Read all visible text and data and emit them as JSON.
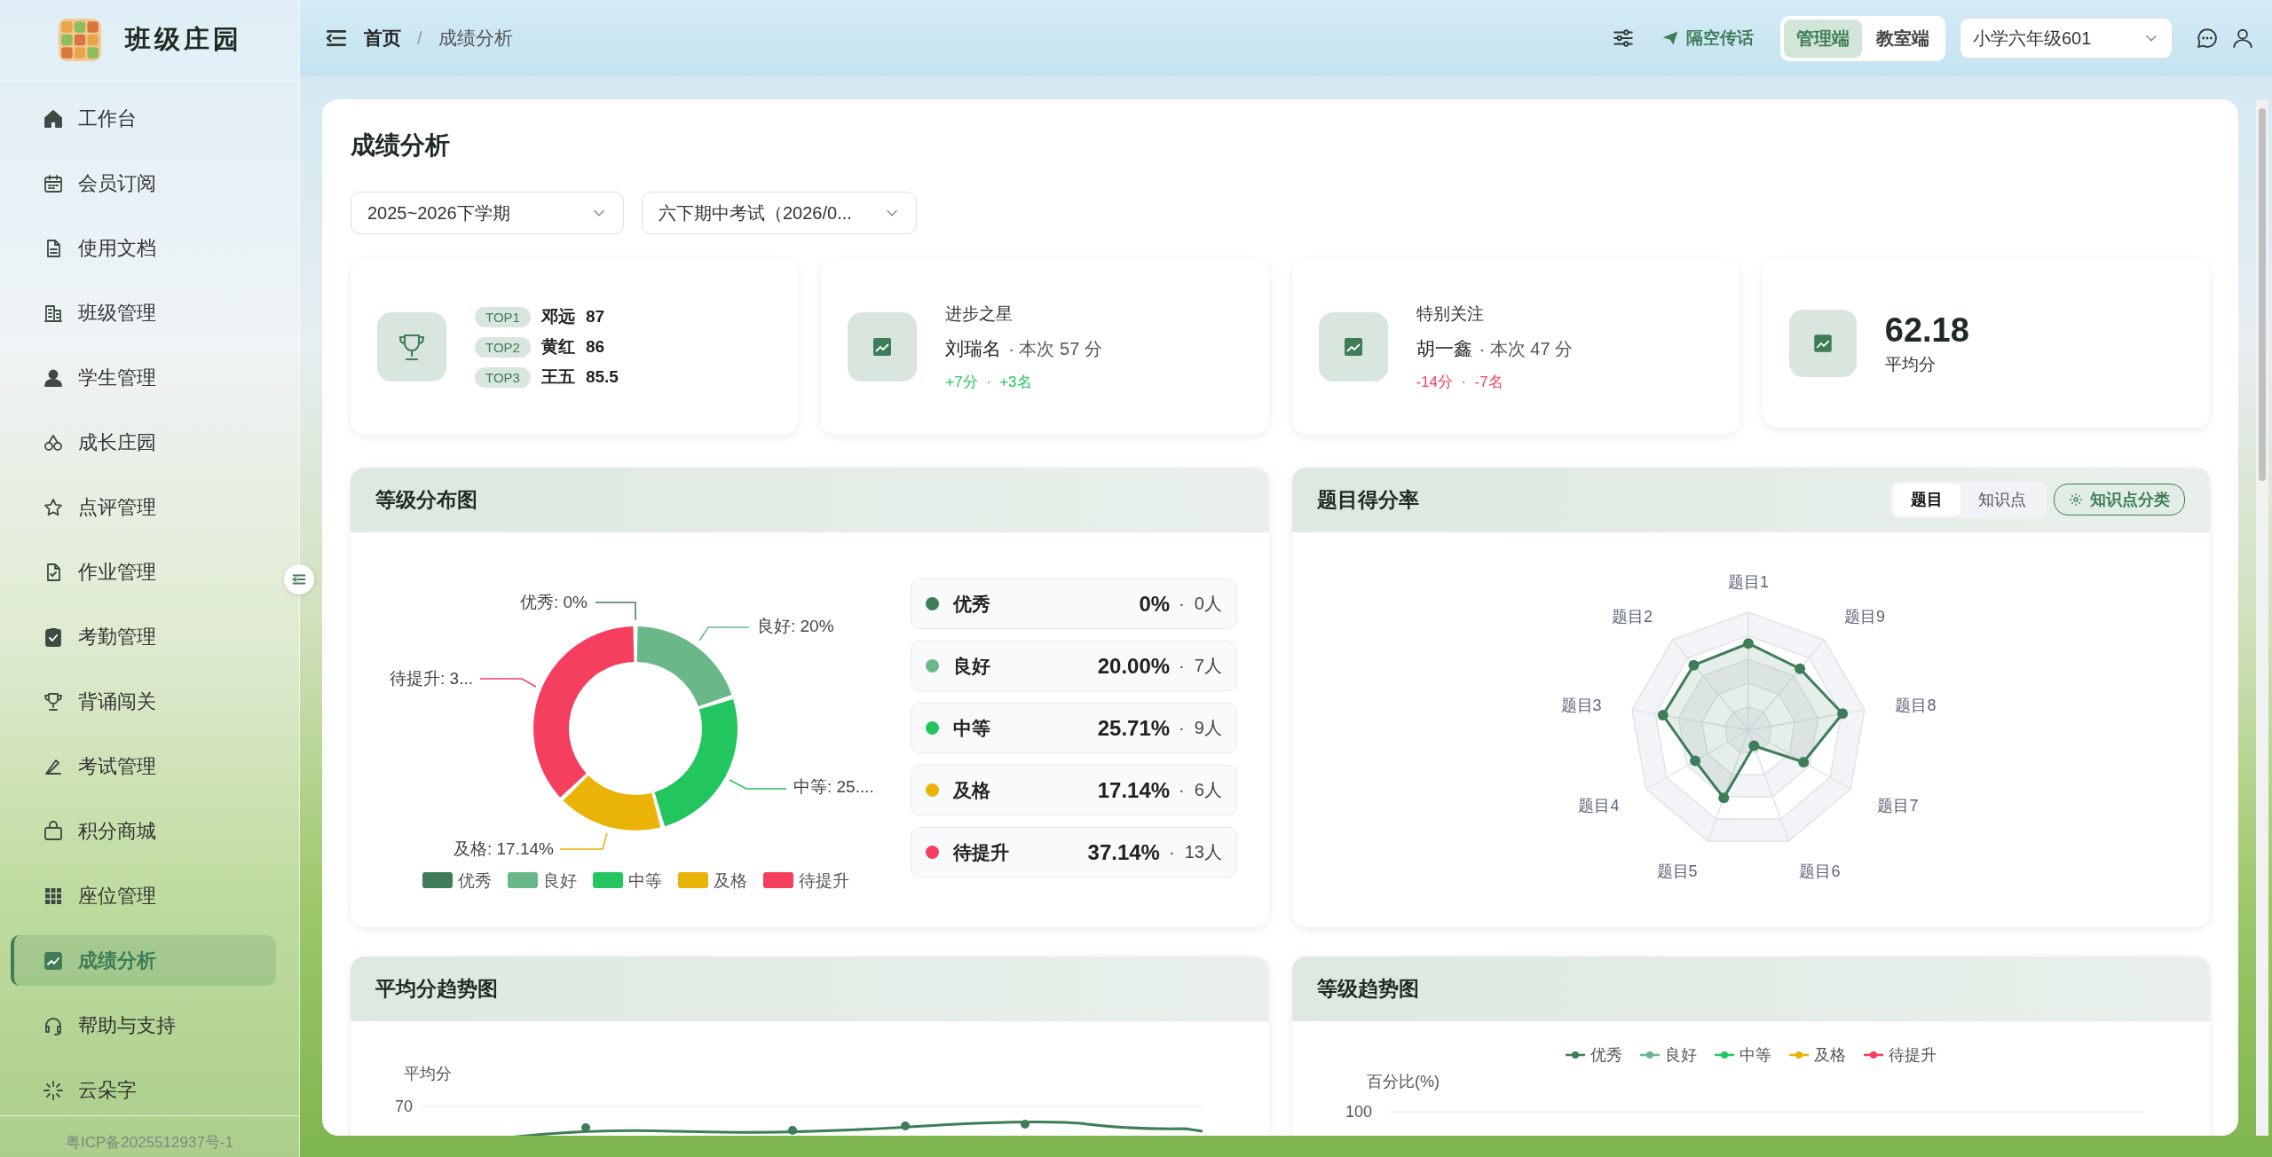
{
  "sidebar": {
    "brand": "班级庄园",
    "items": [
      {
        "label": "工作台",
        "selected": false
      },
      {
        "label": "会员订阅",
        "selected": false
      },
      {
        "label": "使用文档",
        "selected": false
      },
      {
        "label": "班级管理",
        "selected": false
      },
      {
        "label": "学生管理",
        "selected": false
      },
      {
        "label": "成长庄园",
        "selected": false
      },
      {
        "label": "点评管理",
        "selected": false
      },
      {
        "label": "作业管理",
        "selected": false
      },
      {
        "label": "考勤管理",
        "selected": false
      },
      {
        "label": "背诵闯关",
        "selected": false
      },
      {
        "label": "考试管理",
        "selected": false
      },
      {
        "label": "积分商城",
        "selected": false
      },
      {
        "label": "座位管理",
        "selected": false
      },
      {
        "label": "成绩分析",
        "selected": true
      },
      {
        "label": "帮助与支持",
        "selected": false
      },
      {
        "label": "云朵字",
        "selected": false
      }
    ],
    "footer": "粤ICP备2025512937号-1"
  },
  "topbar": {
    "breadcrumb": [
      "首页",
      "成绩分析"
    ],
    "breadcrumb_separator": "/",
    "broadcast": "隔空传话",
    "modes": [
      {
        "label": "管理端",
        "selected": true
      },
      {
        "label": "教室端",
        "selected": false
      }
    ],
    "class_select": {
      "value": "小学六年级601"
    }
  },
  "page": {
    "title": "成绩分析",
    "filters": [
      {
        "value": "2025~2026下学期"
      },
      {
        "value": "六下期中考试（2026/0..."
      }
    ]
  },
  "summary_cards": [
    {
      "kind": "ranking",
      "ranks": [
        {
          "badge": "TOP1",
          "name": "邓远",
          "score": "87"
        },
        {
          "badge": "TOP2",
          "name": "黄红",
          "score": "86"
        },
        {
          "badge": "TOP3",
          "name": "王五",
          "score": "85.5"
        }
      ]
    },
    {
      "kind": "student",
      "title": "进步之星",
      "name": "刘瑞名",
      "detail": "· 本次 57 分",
      "changes": "+7分  ·  +3名",
      "improved": true
    },
    {
      "kind": "student",
      "title": "特别关注",
      "name": "胡一鑫",
      "detail": "· 本次 47 分",
      "changes": "-14分  ·  -7名",
      "improved": false
    },
    {
      "kind": "average",
      "value": "62.18",
      "label": "平均分"
    }
  ],
  "grade_distribution": {
    "title": "等级分布图",
    "chart_data": {
      "type": "donut",
      "categories": [
        "优秀",
        "良好",
        "中等",
        "及格",
        "待提升"
      ],
      "values": [
        0,
        20,
        25.71,
        17.14,
        37.14
      ],
      "colors": [
        "#3e7d57",
        "#6ab88a",
        "#22c55e",
        "#eab308",
        "#f43f5e"
      ],
      "legend": true,
      "value_labels": [
        "优秀: 0%",
        "良好: 20%",
        "中等: 25....",
        "及格: 17.14%",
        "待提升: 3..."
      ]
    },
    "grades": [
      {
        "name": "优秀",
        "color": "#3e7d57",
        "percent": "0%",
        "count": "·  0人"
      },
      {
        "name": "良好",
        "color": "#6ab88a",
        "percent": "20.00%",
        "count": "·  7人"
      },
      {
        "name": "中等",
        "color": "#22c55e",
        "percent": "25.71%",
        "count": "·  9人"
      },
      {
        "name": "及格",
        "color": "#eab308",
        "percent": "17.14%",
        "count": "·  6人"
      },
      {
        "name": "待提升",
        "color": "#f43f5e",
        "percent": "37.14%",
        "count": "·  13人"
      }
    ]
  },
  "question_scores": {
    "title": "题目得分率",
    "tabs": [
      {
        "label": "题目",
        "selected": true
      },
      {
        "label": "知识点",
        "selected": false
      }
    ],
    "classify_button": "知识点分类",
    "axes": [
      "题目1",
      "题目2",
      "题目3",
      "题目4",
      "题目5",
      "题目6",
      "题目7",
      "题目8",
      "题目9"
    ]
  },
  "average_trend": {
    "title": "平均分趋势图",
    "ylabel": "平均分",
    "yticks": [
      "70"
    ]
  },
  "grade_trend": {
    "title": "等级趋势图",
    "legend": [
      {
        "label": "优秀",
        "color": "#3e7d57"
      },
      {
        "label": "良好",
        "color": "#6ab88a"
      },
      {
        "label": "中等",
        "color": "#22c55e"
      },
      {
        "label": "及格",
        "color": "#eab308"
      },
      {
        "label": "待提升",
        "color": "#f43f5e"
      }
    ],
    "ylabel": "百分比(%)",
    "yticks": [
      "100"
    ]
  }
}
